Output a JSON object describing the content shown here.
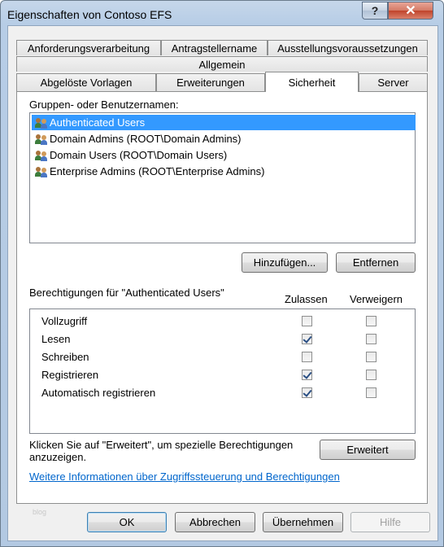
{
  "window": {
    "title": "Eigenschaften von Contoso EFS",
    "help_glyph": "?",
    "close_glyph": "✕"
  },
  "tabs": {
    "row1": [
      "Anforderungsverarbeitung",
      "Antragstellername",
      "Ausstellungsvoraussetzungen"
    ],
    "row2": [
      "Allgemein"
    ],
    "row3": [
      "Abgelöste Vorlagen",
      "Erweiterungen",
      "Sicherheit",
      "Server"
    ],
    "active": "Sicherheit"
  },
  "security": {
    "groups_label": "Gruppen- oder Benutzernamen:",
    "users": [
      {
        "name": "Authenticated Users",
        "selected": true
      },
      {
        "name": "Domain Admins (ROOT\\Domain Admins)",
        "selected": false
      },
      {
        "name": "Domain Users (ROOT\\Domain Users)",
        "selected": false
      },
      {
        "name": "Enterprise Admins (ROOT\\Enterprise Admins)",
        "selected": false
      }
    ],
    "add_button": "Hinzufügen...",
    "remove_button": "Entfernen",
    "permissions_label": "Berechtigungen für \"Authenticated Users\"",
    "allow_header": "Zulassen",
    "deny_header": "Verweigern",
    "permissions": [
      {
        "name": "Vollzugriff",
        "allow": false,
        "deny": false
      },
      {
        "name": "Lesen",
        "allow": true,
        "deny": false
      },
      {
        "name": "Schreiben",
        "allow": false,
        "deny": false
      },
      {
        "name": "Registrieren",
        "allow": true,
        "deny": false
      },
      {
        "name": "Automatisch registrieren",
        "allow": true,
        "deny": false
      }
    ],
    "advanced_text_line1": "Klicken Sie auf \"Erweitert\", um spezielle Berechtigungen",
    "advanced_text_line2": "anzuzeigen.",
    "advanced_button": "Erweitert",
    "info_link": "Weitere Informationen über Zugriffssteuerung und Berechtigungen"
  },
  "footer": {
    "watermark": "blog",
    "ok": "OK",
    "cancel": "Abbrechen",
    "apply": "Übernehmen",
    "help": "Hilfe"
  }
}
